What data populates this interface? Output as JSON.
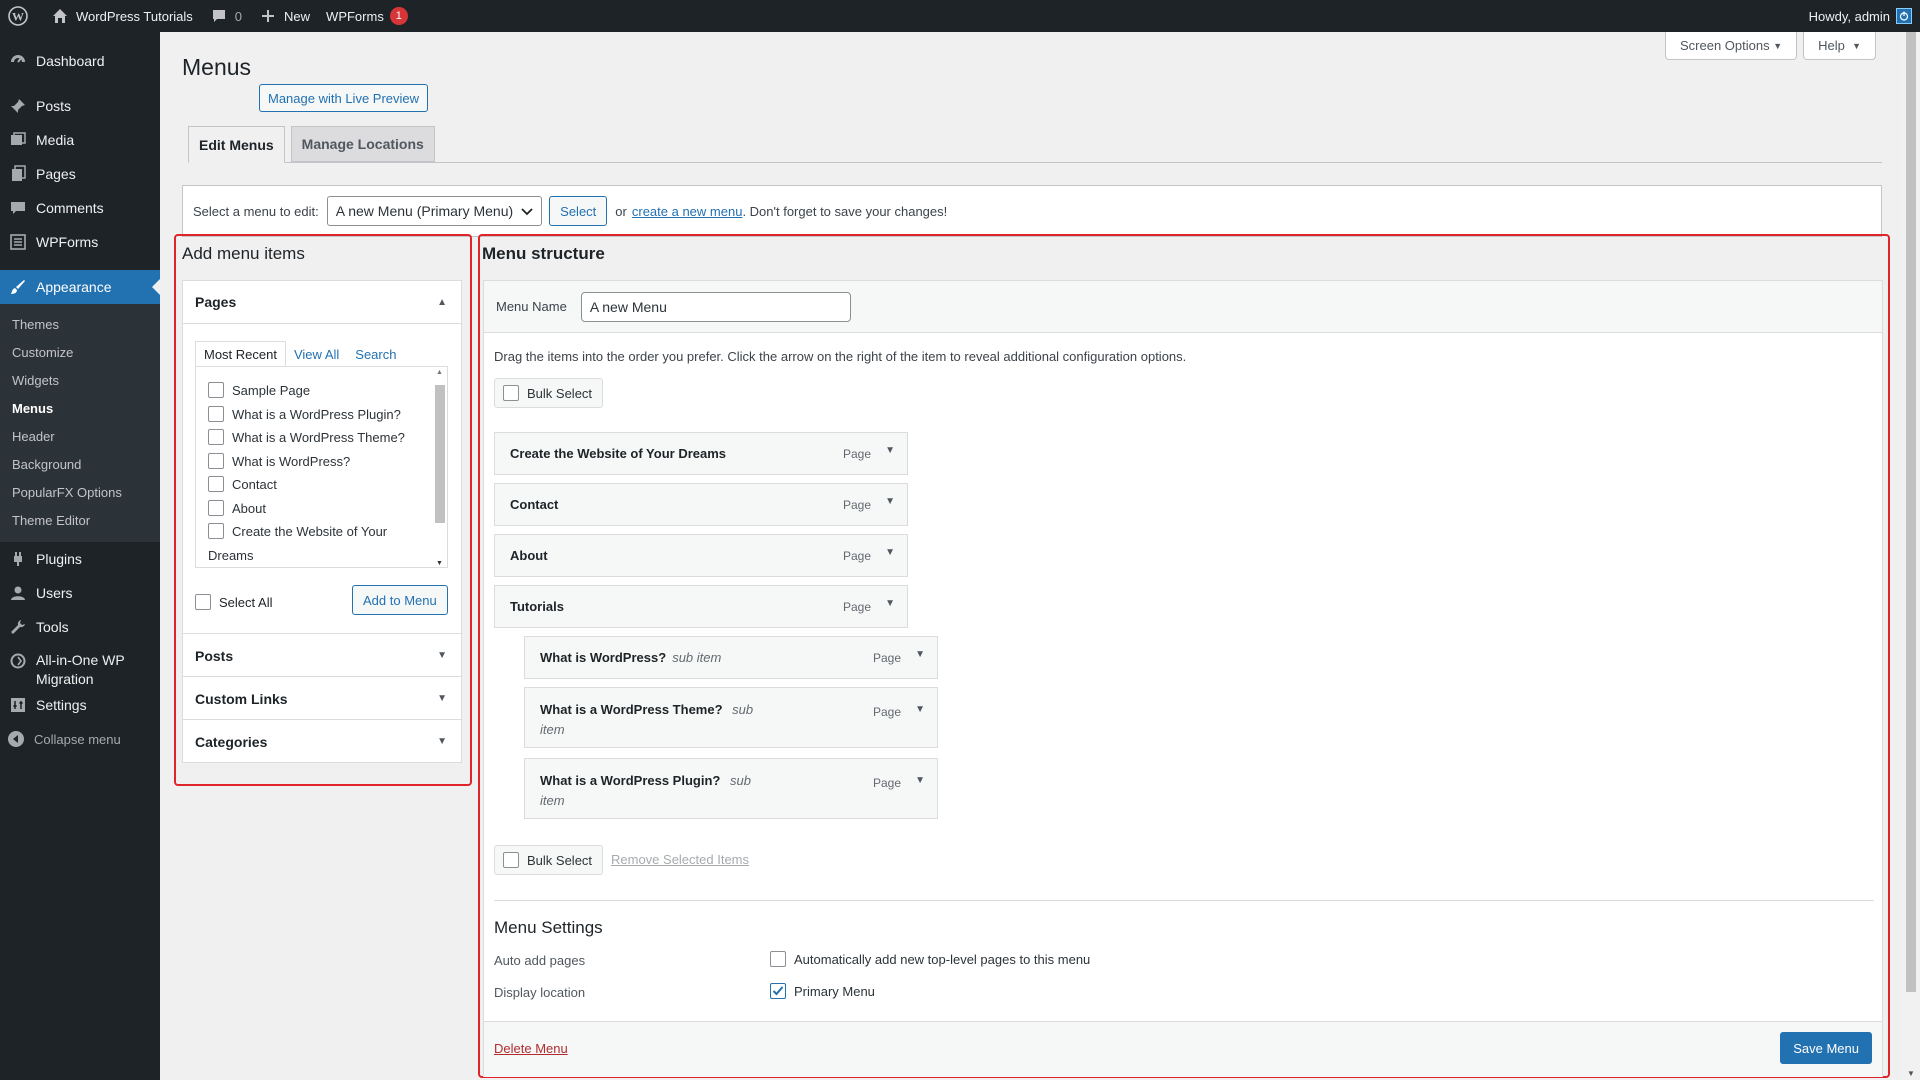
{
  "admin_bar": {
    "site_name": "WordPress Tutorials",
    "comments_count": "0",
    "new_label": "New",
    "wpforms_label": "WPForms",
    "wpforms_badge": "1",
    "howdy": "Howdy, admin"
  },
  "sidebar": {
    "items": [
      {
        "label": "Dashboard",
        "icon": "dashboard-icon"
      },
      {
        "label": "Posts",
        "icon": "pin-icon"
      },
      {
        "label": "Media",
        "icon": "media-icon"
      },
      {
        "label": "Pages",
        "icon": "pages-icon"
      },
      {
        "label": "Comments",
        "icon": "comment-icon"
      },
      {
        "label": "WPForms",
        "icon": "forms-icon"
      },
      {
        "label": "Appearance",
        "icon": "brush-icon"
      },
      {
        "label": "Plugins",
        "icon": "plugin-icon"
      },
      {
        "label": "Users",
        "icon": "users-icon"
      },
      {
        "label": "Tools",
        "icon": "tools-icon"
      },
      {
        "label": "All-in-One WP Migration",
        "icon": "migration-icon"
      },
      {
        "label": "Settings",
        "icon": "settings-icon"
      }
    ],
    "appearance_sub": [
      "Themes",
      "Customize",
      "Widgets",
      "Menus",
      "Header",
      "Background",
      "PopularFX Options",
      "Theme Editor"
    ],
    "collapse": "Collapse menu"
  },
  "screen_meta": {
    "screen_options": "Screen Options",
    "help": "Help"
  },
  "page": {
    "title": "Menus",
    "live_preview": "Manage with Live Preview",
    "tabs": [
      "Edit Menus",
      "Manage Locations"
    ]
  },
  "manage": {
    "label": "Select a menu to edit:",
    "selected": "A new Menu (Primary Menu)",
    "select_btn": "Select",
    "or": "or",
    "create_link": "create a new menu",
    "tail": ". Don't forget to save your changes!"
  },
  "add_items": {
    "title": "Add menu items",
    "pages": {
      "header": "Pages",
      "tabs": [
        "Most Recent",
        "View All",
        "Search"
      ],
      "list": [
        "Sample Page",
        "What is a WordPress Plugin?",
        "What is a WordPress Theme?",
        "What is WordPress?",
        "Contact",
        "About",
        "Create the Website of Your",
        "Dreams"
      ],
      "select_all": "Select All",
      "add_btn": "Add to Menu"
    },
    "sections": [
      "Posts",
      "Custom Links",
      "Categories"
    ]
  },
  "structure": {
    "title": "Menu structure",
    "name_label": "Menu Name",
    "name_value": "A new Menu",
    "instructions": "Drag the items into the order you prefer. Click the arrow on the right of the item to reveal additional configuration options.",
    "bulk_select": "Bulk Select",
    "items": [
      {
        "title": "Create the Website of Your Dreams",
        "type": "Page",
        "sub": ""
      },
      {
        "title": "Contact",
        "type": "Page",
        "sub": ""
      },
      {
        "title": "About",
        "type": "Page",
        "sub": ""
      },
      {
        "title": "Tutorials",
        "type": "Page",
        "sub": ""
      },
      {
        "title": "What is WordPress?",
        "type": "Page",
        "sub": "sub item"
      },
      {
        "title": "What is a WordPress Theme?",
        "type": "Page",
        "sub": "sub",
        "sub2": "item"
      },
      {
        "title": "What is a WordPress Plugin?",
        "type": "Page",
        "sub": "sub",
        "sub2": "item"
      }
    ],
    "remove_selected": "Remove Selected Items",
    "settings": {
      "title": "Menu Settings",
      "auto_add_label": "Auto add pages",
      "auto_add_text": "Automatically add new top-level pages to this menu",
      "display_label": "Display location",
      "primary": "Primary Menu"
    },
    "delete": "Delete Menu",
    "save": "Save Menu"
  },
  "colors": {
    "accent": "#2271b1",
    "highlight": "#e0242b",
    "admin_bg": "#1d2327"
  }
}
